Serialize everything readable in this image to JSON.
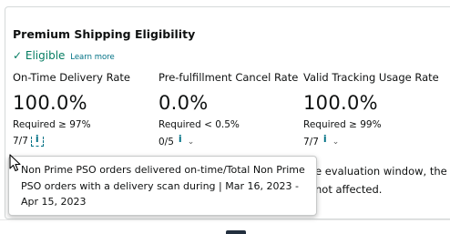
{
  "card": {
    "title": "Premium Shipping Eligibility",
    "eligible_label": "✓ Eligible",
    "learn_more": "Learn more"
  },
  "metrics": [
    {
      "label": "On-Time Delivery Rate",
      "value": "100.0%",
      "requirement": "Required ≥ 97%",
      "count": "7/7"
    },
    {
      "label": "Pre-fulfillment Cancel Rate",
      "value": "0.0%",
      "requirement": "Required < 0.5%",
      "count": "0/5"
    },
    {
      "label": "Valid Tracking Usage Rate",
      "value": "100.0%",
      "requirement": "Required ≥ 99%",
      "count": "7/7"
    }
  ],
  "info_icon": "i",
  "chevron": "⌄",
  "background_text": {
    "line1": "e evaluation window, the",
    "line2": "not affected."
  },
  "tooltip": {
    "text": "Non Prime PSO orders delivered on-time/Total Non Prime PSO orders with a delivery scan during | Mar 16, 2023 - Apr 15, 2023"
  },
  "icons": {
    "info": "info-icon",
    "chevron": "chevron-down-icon",
    "cursor": "mouse-pointer-icon"
  },
  "colors": {
    "eligible": "#067d62",
    "link": "#007185",
    "text": "#0f1111"
  }
}
